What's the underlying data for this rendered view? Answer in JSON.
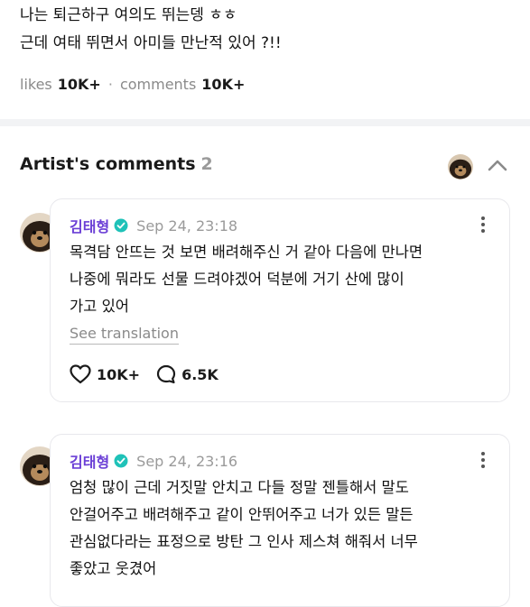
{
  "post": {
    "lines": [
      "나는 퇴근하구 여의도 뛰는뎅 ㅎㅎ",
      "근데 여태 뛰면서 아미들 만난적 있어 ?!!"
    ],
    "likes_label": "likes",
    "likes_value": "10K+",
    "separator": "·",
    "comments_label": "comments",
    "comments_value": "10K+"
  },
  "section": {
    "title": "Artist's comments",
    "count": "2"
  },
  "comments": [
    {
      "author": "김태형",
      "date": "Sep 24, 23:18",
      "lines": [
        "목격담 안뜨는 것 보면 배려해주신 거 같아 다음에 만나면",
        "나중에 뭐라도 선물 드려야겠어 덕분에 거기 산에 많이",
        "가고 있어"
      ],
      "see_translation": "See translation",
      "likes": "10K+",
      "replies": "6.5K"
    },
    {
      "author": "김태형",
      "date": "Sep 24, 23:16",
      "lines": [
        "엄청 많이 근데 거짓말 안치고 다들 정말 젠틀해서 말도",
        "안걸어주고 배려해주고 같이 안뛰어주고 너가 있든 말든",
        "관심없다라는 표정으로 방탄 그 인사 제스쳐 해줘서 너무",
        "좋았고 웃겼어"
      ]
    }
  ],
  "icons": {
    "verified": "verified-badge-icon",
    "more": "more-vertical-icon",
    "like": "heart-icon",
    "reply": "speech-bubble-icon",
    "collapse": "chevron-up-icon"
  },
  "colors": {
    "author": "#6b3fd6",
    "badge": "#1fc2b8",
    "muted": "#8a8a8a"
  }
}
